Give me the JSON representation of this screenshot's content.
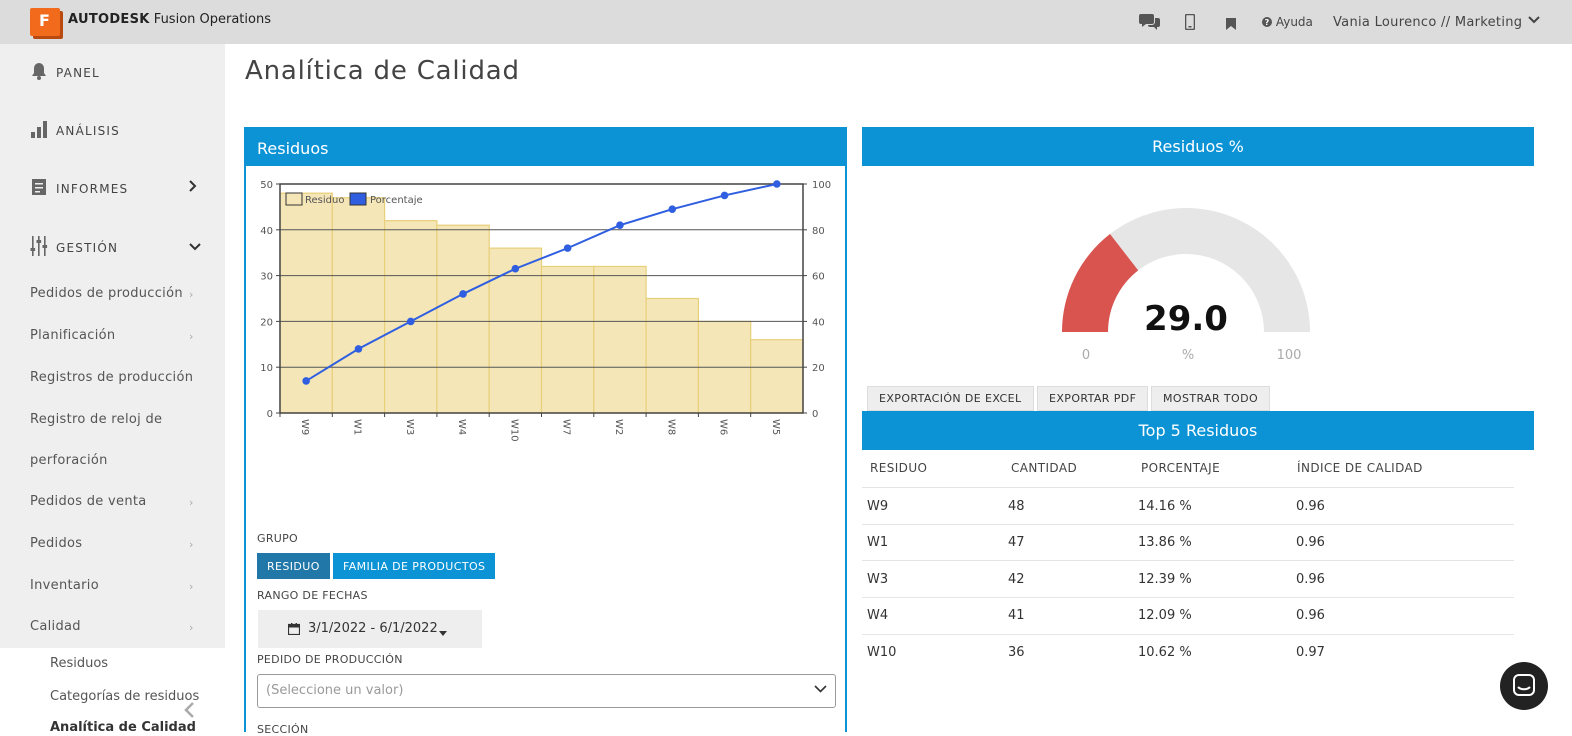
{
  "app": {
    "logo_letter": "F",
    "brand_bold": "AUTODESK",
    "brand_rest": "Fusion Operations"
  },
  "header": {
    "help_label": "Ayuda",
    "user_label": "Vania Lourenco // Marketing",
    "icons": [
      "chat-icon",
      "mobile-icon",
      "bookmark-icon",
      "help-icon",
      "chevron-down-icon"
    ]
  },
  "sidebar": {
    "main": [
      {
        "label": "PANEL",
        "icon": "bell-icon"
      },
      {
        "label": "ANÁLISIS",
        "icon": "bar-chart-icon"
      },
      {
        "label": "INFORMES",
        "icon": "report-icon"
      },
      {
        "label": "GESTIÓN",
        "icon": "sliders-icon"
      }
    ],
    "items": [
      "Pedidos de producción",
      "Planificación",
      "Registros de producción",
      "Registro de reloj de",
      "perforación",
      "Pedidos de venta",
      "Pedidos",
      "Inventario",
      "Calidad"
    ],
    "sub_items": [
      "Residuos",
      "Categorías de residuos",
      "Analítica de Calidad"
    ]
  },
  "page": {
    "title": "Analítica de Calidad"
  },
  "residuos_panel": {
    "title": "Residuos",
    "grupo_label": "GRUPO",
    "grupo_buttons": [
      "RESIDUO",
      "FAMILIA DE PRODUCTOS"
    ],
    "rango_label": "RANGO DE FECHAS",
    "date_range": "3/1/2022 - 6/1/2022",
    "pedido_label": "PEDIDO DE PRODUCCIÓN",
    "pedido_placeholder": "(Seleccione un valor)",
    "seccion_label": "SECCIÓN"
  },
  "chart_data": {
    "type": "bar",
    "categories": [
      "W9",
      "W1",
      "W3",
      "W4",
      "W10",
      "W7",
      "W2",
      "W8",
      "W6",
      "W5"
    ],
    "series": [
      {
        "name": "Residuo",
        "values": [
          48,
          47,
          42,
          41,
          36,
          32,
          32,
          25,
          20,
          16
        ],
        "color": "#f5e6b8",
        "axis": "left"
      },
      {
        "name": "Porcentaje",
        "values": [
          14,
          28,
          40,
          52,
          63,
          72,
          82,
          89,
          95,
          100
        ],
        "color": "#2f5fe0",
        "axis": "right",
        "type": "line"
      }
    ],
    "ylim": [
      0,
      50
    ],
    "y_ticks": [
      0,
      10,
      20,
      30,
      40,
      50
    ],
    "y2lim": [
      0,
      100
    ],
    "y2_ticks": [
      0,
      20,
      40,
      60,
      80,
      100
    ],
    "legend": "top-left",
    "grid": true
  },
  "gauge": {
    "title": "Residuos %",
    "value": 29.0,
    "value_label": "29.0",
    "min_label": "0",
    "unit_label": "%",
    "max_label": "100",
    "fill_color": "#d9534f",
    "track_color": "#e6e6e6"
  },
  "actions": [
    "EXPORTACIÓN DE EXCEL",
    "EXPORTAR PDF",
    "MOSTRAR TODO"
  ],
  "top5": {
    "title": "Top 5 Residuos",
    "headers": [
      "RESIDUO",
      "CANTIDAD",
      "PORCENTAJE",
      "ÍNDICE DE CALIDAD"
    ],
    "rows": [
      [
        "W9",
        "48",
        "14.16 %",
        "0.96"
      ],
      [
        "W1",
        "47",
        "13.86 %",
        "0.96"
      ],
      [
        "W3",
        "42",
        "12.39 %",
        "0.96"
      ],
      [
        "W4",
        "41",
        "12.09 %",
        "0.96"
      ],
      [
        "W10",
        "36",
        "10.62 %",
        "0.97"
      ]
    ]
  }
}
